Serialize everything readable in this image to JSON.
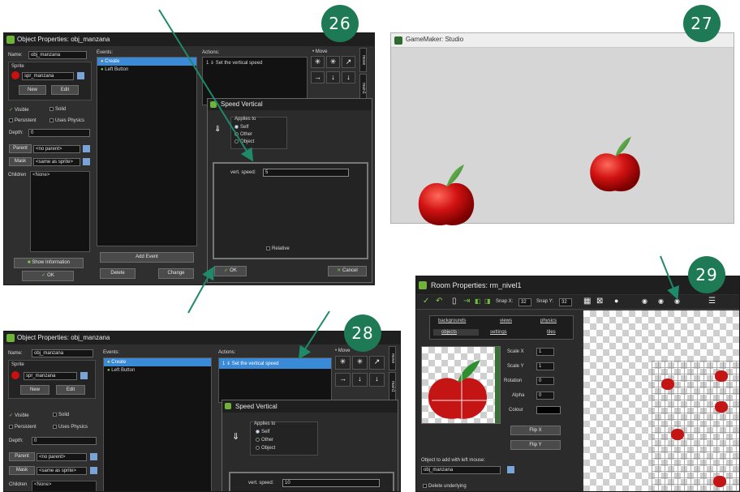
{
  "badges": [
    "26",
    "27",
    "28",
    "29"
  ],
  "win26": {
    "title": "Object Properties: obj_manzana",
    "name_label": "Name:",
    "name_value": "obj_manzana",
    "sprite_group": "Sprite",
    "sprite_value": "spr_manzana",
    "new_label": "New",
    "edit_label": "Edit",
    "visible_label": "Visible",
    "solid_label": "Solid",
    "persistent_label": "Persistent",
    "uses_physics_label": "Uses Physics",
    "depth_label": "Depth:",
    "depth_value": "0",
    "parent_label": "Parent",
    "parent_value": "<no parent>",
    "mask_label": "Mask",
    "mask_value": "<same as sprite>",
    "children_label": "Children",
    "children_value": "<None>",
    "show_info_label": "Show Information",
    "ok_label": "OK",
    "events_header": "Events:",
    "events": [
      "Create",
      "Left Button"
    ],
    "add_event_label": "Add Event",
    "delete_label": "Delete",
    "change_label": "Change",
    "actions_header": "Actions:",
    "action_item": "Set the vertical speed",
    "move_label": "Move",
    "tab_move": "move",
    "tab_main1": "main1"
  },
  "speed26": {
    "title": "Speed Vertical",
    "applies_to": "Applies to",
    "self": "Self",
    "other": "Other",
    "object": "Object",
    "vert_speed_label": "vert. speed:",
    "vert_speed_value": "5",
    "relative_label": "Relative",
    "ok_label": "OK",
    "cancel_label": "Cancel"
  },
  "win27": {
    "title": "GameMaker: Studio"
  },
  "win28": {
    "title": "Object Properties: obj_manzana",
    "name_label": "Name:",
    "name_value": "obj_manzana",
    "sprite_group": "Sprite",
    "sprite_value": "spr_manzana",
    "new_label": "New",
    "edit_label": "Edit",
    "visible_label": "Visible",
    "solid_label": "Solid",
    "persistent_label": "Persistent",
    "uses_physics_label": "Uses Physics",
    "depth_label": "Depth:",
    "depth_value": "0",
    "parent_label": "Parent",
    "parent_value": "<no parent>",
    "mask_label": "Mask",
    "mask_value": "<same as sprite>",
    "children_label": "Children",
    "children_value": "<None>",
    "events_header": "Events:",
    "events": [
      "Create",
      "Left Button"
    ],
    "actions_header": "Actions:",
    "action_item": "Set the vertical speed",
    "move_label": "Move",
    "tab_move": "move",
    "tab_main1": "main1"
  },
  "speed28": {
    "title": "Speed Vertical",
    "applies_to": "Applies to",
    "self": "Self",
    "other": "Other",
    "object": "Object",
    "vert_speed_label": "vert. speed:",
    "vert_speed_value": "10"
  },
  "win29": {
    "title": "Room Properties: rm_nivel1",
    "snap_x_label": "Snap X:",
    "snap_x_value": "32",
    "snap_y_label": "Snap Y:",
    "snap_y_value": "32",
    "tabs_row1": [
      "backgrounds",
      "views",
      "physics"
    ],
    "tabs_row2": [
      "objects",
      "settings",
      "tiles"
    ],
    "scale_x_label": "Scale X",
    "scale_x_value": "1",
    "scale_y_label": "Scale Y",
    "scale_y_value": "1",
    "rotation_label": "Rotation",
    "rotation_value": "0",
    "alpha_label": "Alpha",
    "alpha_value": "0",
    "colour_label": "Colour",
    "flip_x_label": "Flip X",
    "flip_y_label": "Flip Y",
    "object_add_label": "Object to add with left mouse:",
    "object_add_value": "obj_manzana",
    "delete_underlying_label": "Delete underlying"
  },
  "colors": {
    "badge": "#1d7a55",
    "arrow": "#1e8a6a",
    "apple_red": "#cc1010",
    "leaf_green": "#2f8f2f",
    "selection_blue": "#3a8ad8"
  }
}
